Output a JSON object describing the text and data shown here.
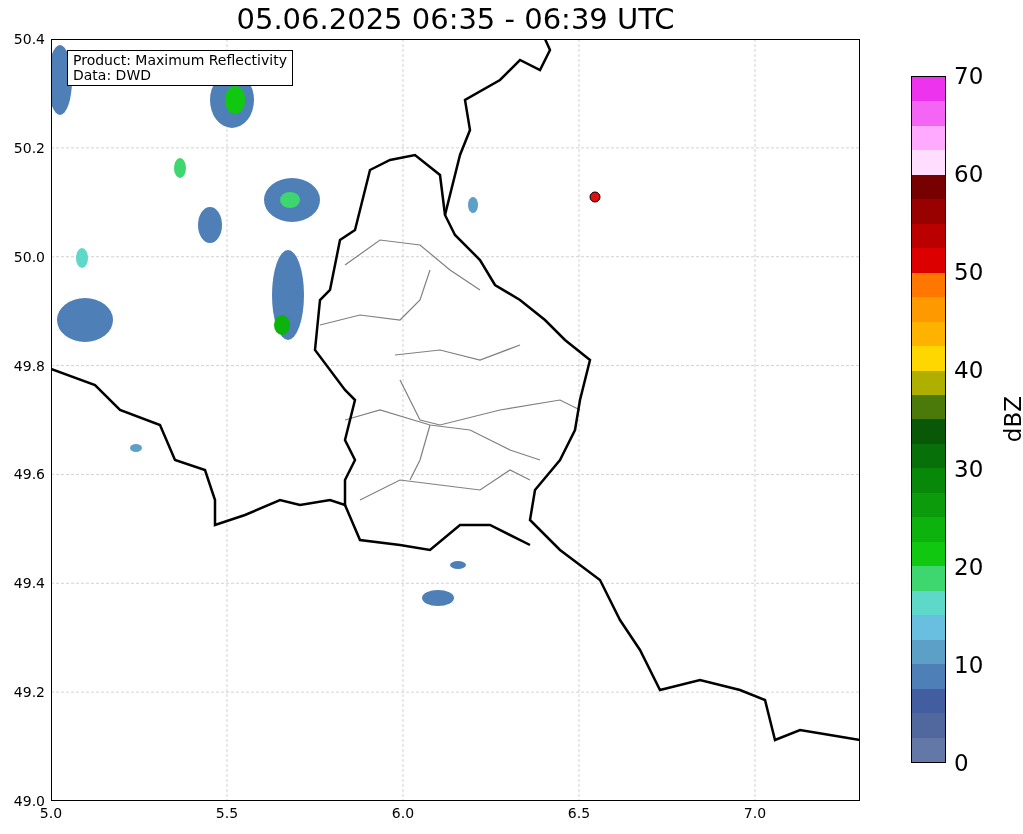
{
  "title": "05.06.2025 06:35 - 06:39 UTC",
  "info_box": {
    "lines": [
      "Product: Maximum Reflectivity",
      "Data: DWD"
    ]
  },
  "x_axis": {
    "ticks": [
      "5.0",
      "5.5",
      "6.0",
      "6.5",
      "7.0"
    ]
  },
  "y_axis": {
    "ticks": [
      "50.4",
      "50.2",
      "50.0",
      "49.8",
      "49.6",
      "49.4",
      "49.2",
      "49.0"
    ]
  },
  "colorbar": {
    "label": "dBZ",
    "ticks": [
      "70",
      "60",
      "50",
      "40",
      "30",
      "20",
      "10",
      "0"
    ],
    "bands": [
      {
        "color": "#6478a8"
      },
      {
        "color": "#51689f"
      },
      {
        "color": "#425ea0"
      },
      {
        "color": "#4e7fb7"
      },
      {
        "color": "#5c9fc7"
      },
      {
        "color": "#68bfdf"
      },
      {
        "color": "#5ed8c8"
      },
      {
        "color": "#3ed66e"
      },
      {
        "color": "#10c810"
      },
      {
        "color": "#0db30d"
      },
      {
        "color": "#0b9b0b"
      },
      {
        "color": "#088808"
      },
      {
        "color": "#087008"
      },
      {
        "color": "#085808"
      },
      {
        "color": "#4b7a0a"
      },
      {
        "color": "#afaf00"
      },
      {
        "color": "#ffd700"
      },
      {
        "color": "#ffb300"
      },
      {
        "color": "#ff9900"
      },
      {
        "color": "#ff7700"
      },
      {
        "color": "#dd0000"
      },
      {
        "color": "#bb0000"
      },
      {
        "color": "#990000"
      },
      {
        "color": "#770000"
      },
      {
        "color": "#ffddff"
      },
      {
        "color": "#ffaaff"
      },
      {
        "color": "#f565f5"
      },
      {
        "color": "#ee33ee"
      }
    ]
  }
}
